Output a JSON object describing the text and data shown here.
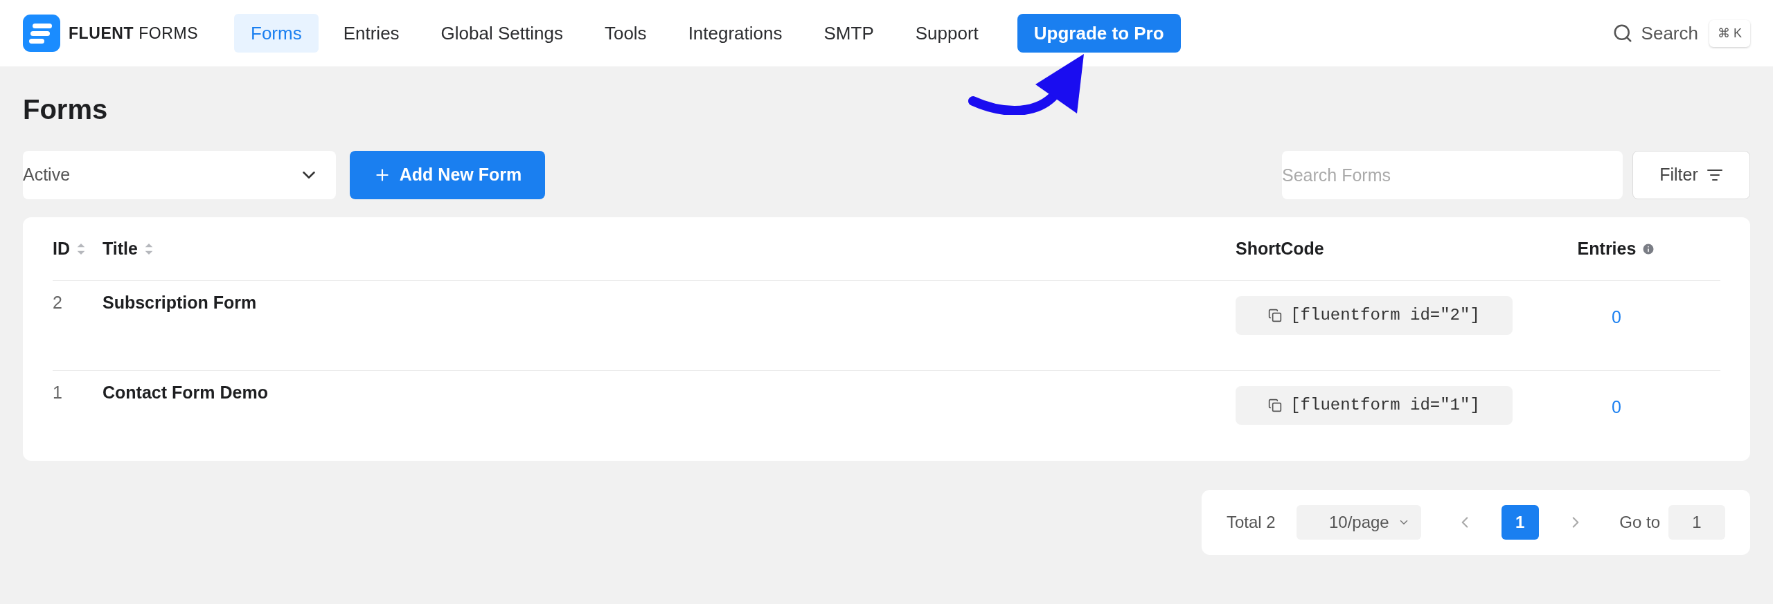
{
  "brand": {
    "bold": "FLUENT",
    "light": "FORMS"
  },
  "nav": [
    {
      "label": "Forms",
      "selected": true
    },
    {
      "label": "Entries",
      "selected": false
    },
    {
      "label": "Global Settings",
      "selected": false
    },
    {
      "label": "Tools",
      "selected": false
    },
    {
      "label": "Integrations",
      "selected": false
    },
    {
      "label": "SMTP",
      "selected": false
    },
    {
      "label": "Support",
      "selected": false
    }
  ],
  "upgrade_button": "Upgrade to Pro",
  "header_search": {
    "label": "Search",
    "shortcut": "⌘ K"
  },
  "page_title": "Forms",
  "status_select": {
    "value": "Active"
  },
  "add_button": "Add New Form",
  "search_forms": {
    "placeholder": "Search Forms"
  },
  "filter_button": "Filter",
  "table": {
    "columns": [
      {
        "label": "ID",
        "sortable": true
      },
      {
        "label": "Title",
        "sortable": true
      },
      {
        "label": "ShortCode",
        "sortable": false
      },
      {
        "label": "Entries",
        "sortable": false,
        "info": true
      }
    ],
    "rows": [
      {
        "id": "2",
        "title": "Subscription Form",
        "shortcode": "[fluentform id=\"2\"]",
        "entries": "0"
      },
      {
        "id": "1",
        "title": "Contact Form Demo",
        "shortcode": "[fluentform id=\"1\"]",
        "entries": "0"
      }
    ]
  },
  "pagination": {
    "total": "Total 2",
    "page_size": "10/page",
    "pages": [
      {
        "label": "1",
        "selected": true
      }
    ],
    "goto_label": "Go to",
    "goto_value": "1"
  }
}
